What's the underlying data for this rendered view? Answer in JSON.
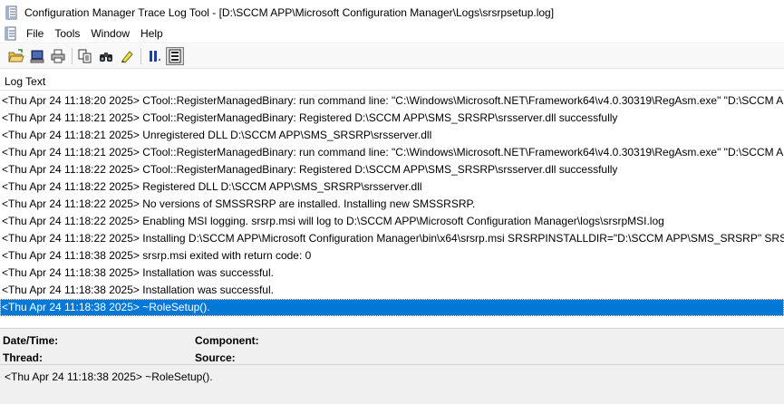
{
  "window": {
    "title": "Configuration Manager Trace Log Tool - [D:\\SCCM APP\\Microsoft Configuration Manager\\Logs\\srsrpsetup.log]"
  },
  "menu": {
    "items": [
      "File",
      "Tools",
      "Window",
      "Help"
    ]
  },
  "toolbar": {
    "buttons": [
      "open-folder-icon",
      "open-on-server-icon",
      "print-icon",
      "copy-icon",
      "find-icon",
      "highlight-icon",
      "pause-icon",
      "error-lookup-icon"
    ]
  },
  "columns": {
    "log_text": "Log Text"
  },
  "log": {
    "rows": [
      "<Thu Apr 24 11:18:20 2025> CTool::RegisterManagedBinary: run command line: \"C:\\Windows\\Microsoft.NET\\Framework64\\v4.0.30319\\RegAsm.exe\" \"D:\\SCCM APP\\SMS_SRSRP\\srsserver.dll\"",
      "<Thu Apr 24 11:18:21 2025> CTool::RegisterManagedBinary: Registered D:\\SCCM APP\\SMS_SRSRP\\srsserver.dll successfully",
      "<Thu Apr 24 11:18:21 2025> Unregistered DLL D:\\SCCM APP\\SMS_SRSRP\\srsserver.dll",
      "<Thu Apr 24 11:18:21 2025> CTool::RegisterManagedBinary: run command line: \"C:\\Windows\\Microsoft.NET\\Framework64\\v4.0.30319\\RegAsm.exe\" \"D:\\SCCM APP\\SMS_SRSRP\\srsserver.dll\"",
      "<Thu Apr 24 11:18:22 2025> CTool::RegisterManagedBinary: Registered D:\\SCCM APP\\SMS_SRSRP\\srsserver.dll successfully",
      "<Thu Apr 24 11:18:22 2025> Registered DLL D:\\SCCM APP\\SMS_SRSRP\\srsserver.dll",
      "<Thu Apr 24 11:18:22 2025> No versions of SMSSRSRP are installed.  Installing new SMSSRSRP.",
      "<Thu Apr 24 11:18:22 2025> Enabling MSI logging.  srsrp.msi will log to D:\\SCCM APP\\Microsoft Configuration Manager\\logs\\srsrpMSI.log",
      "<Thu Apr 24 11:18:22 2025> Installing D:\\SCCM APP\\Microsoft Configuration Manager\\bin\\x64\\srsrp.msi SRSRPINSTALLDIR=\"D:\\SCCM APP\\SMS_SRSRP\" SRSRPLANGPACKFLAGS=",
      "<Thu Apr 24 11:18:38 2025> srsrp.msi exited with return code: 0",
      "<Thu Apr 24 11:18:38 2025> Installation was successful.",
      "<Thu Apr 24 11:18:38 2025> Installation was successful.",
      "<Thu Apr 24 11:18:38 2025> ~RoleSetup()."
    ],
    "selected_index": 12
  },
  "details": {
    "datetime_label": "Date/Time:",
    "component_label": "Component:",
    "thread_label": "Thread:",
    "source_label": "Source:",
    "message": "<Thu Apr 24 11:18:38 2025> ~RoleSetup()."
  },
  "colors": {
    "selection": "#0078d7",
    "panel": "#f0f0f0"
  }
}
